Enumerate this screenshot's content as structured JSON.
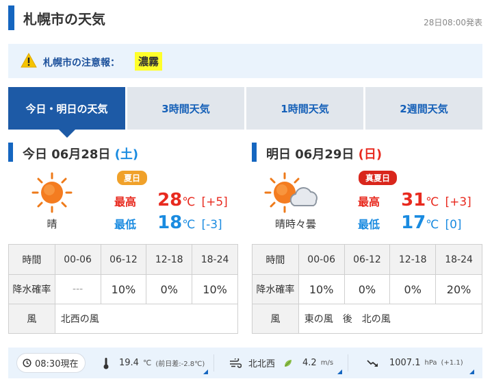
{
  "header": {
    "title": "札幌市の天気",
    "announced": "28日08:00発表"
  },
  "alert": {
    "icon": "warning-icon",
    "label": "札幌市の注意報：",
    "warning": "濃霧",
    "warning_color": "#ffff2a"
  },
  "tabs": [
    {
      "label": "今日・明日の天気",
      "active": true
    },
    {
      "label": "3時間天気",
      "active": false
    },
    {
      "label": "1時間天気",
      "active": false
    },
    {
      "label": "2週間天気",
      "active": false
    }
  ],
  "today": {
    "prefix": "今日",
    "date": "06月28日",
    "dow": "(土)",
    "icon": "sun-icon",
    "weather": "晴",
    "badge": "夏日",
    "high_label": "最高",
    "high": "28",
    "high_diff": "[+5]",
    "low_label": "最低",
    "low": "18",
    "low_diff": "[-3]",
    "unit": "℃"
  },
  "tomorrow": {
    "prefix": "明日",
    "date": "06月29日",
    "dow": "(日)",
    "icon": "sun-cloud-icon",
    "weather": "晴時々曇",
    "badge": "真夏日",
    "high_label": "最高",
    "high": "31",
    "high_diff": "[+3]",
    "low_label": "最低",
    "low": "17",
    "low_diff": "[0]",
    "unit": "℃"
  },
  "table": {
    "time_label": "時間",
    "periods": [
      "00-06",
      "06-12",
      "12-18",
      "18-24"
    ],
    "precip_label": "降水確率",
    "wind_label": "風",
    "today_precip": [
      "---",
      "10%",
      "0%",
      "10%"
    ],
    "today_wind": "北西の風",
    "tomorrow_precip": [
      "10%",
      "0%",
      "0%",
      "20%"
    ],
    "tomorrow_wind": "東の風　後　北の風"
  },
  "observation": {
    "time": "08:30現在",
    "temp_value": "19.4",
    "temp_unit": "℃",
    "temp_diff": "(前日差:-2.8℃)",
    "wind_dir": "北北西",
    "wind_speed": "4.2",
    "wind_unit": "m/s",
    "pressure": "1007.1",
    "pressure_unit": "hPa",
    "pressure_diff": "(+1.1)"
  },
  "colors": {
    "accent": "#1566c0",
    "tab_active": "#1d5aa6",
    "high": "#e82a1f",
    "low": "#1a8be0",
    "saturday": "#1a8be0",
    "sunday": "#e82a1f",
    "badge_summer": "#f0a12a",
    "badge_hot": "#d9261c"
  }
}
